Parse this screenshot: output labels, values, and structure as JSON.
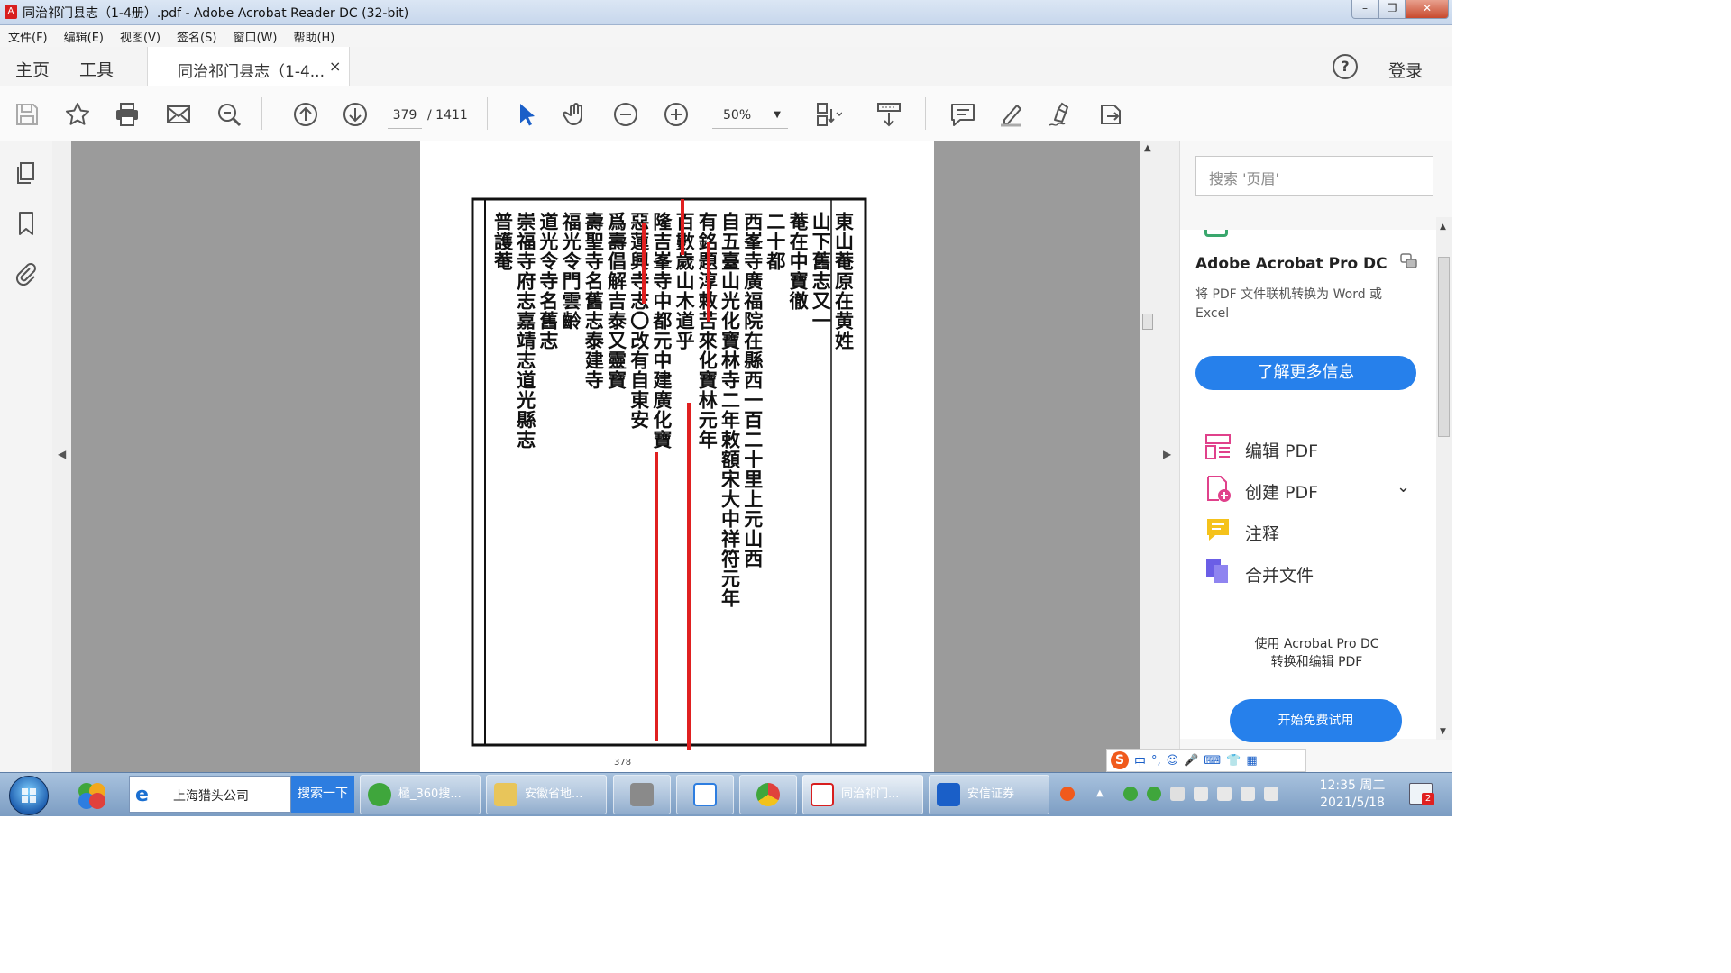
{
  "window": {
    "title": "同治祁门县志（1-4册）.pdf - Adobe Acrobat Reader DC (32-bit)",
    "app_icon": "pdf-icon",
    "controls": [
      "minimize",
      "maximize",
      "close"
    ]
  },
  "menu": [
    "文件(F)",
    "编辑(E)",
    "视图(V)",
    "签名(S)",
    "窗口(W)",
    "帮助(H)"
  ],
  "tabs": {
    "home": "主页",
    "tools": "工具",
    "document": "同治祁门县志（1-4...",
    "close_glyph": "×",
    "help_glyph": "?",
    "login": "登录"
  },
  "toolbar": {
    "current_page": "379",
    "total_pages": "/ 1411",
    "zoom": "50%",
    "zoom_arrow": "▼",
    "icons": [
      "save-icon",
      "star-icon",
      "print-icon",
      "mail-icon",
      "find-zoom-icon",
      "page-up-icon",
      "page-down-icon",
      "select-cursor-icon",
      "hand-icon",
      "zoom-out-icon",
      "zoom-in-icon",
      "page-layout-icon",
      "scroll-mode-icon",
      "comment-icon",
      "highlight-pen-icon",
      "sign-icon",
      "send-icon"
    ]
  },
  "page": {
    "columns": [
      "東山菴原在黄姓",
      "山下舊志又一",
      "菴在中寶徹",
      "二十都",
      "西峯寺廣福院在縣西一百二十里上元山西",
      "自五臺山光化寶林寺二年敕額宋大中祥符元年",
      "有銘題淳敕苦來化寶林元年",
      "百數歲山木道乎",
      "隆吉峯寺中都元中建廣化寶",
      "惡蓮興寺志〇改有自東安",
      "爲壽倡解吉泰又靈寶",
      "壽聖寺名舊志泰建寺",
      "福光令門雲齡",
      "道光令寺名舊志",
      "崇福寺府志嘉靖志道光縣志",
      "普護菴"
    ],
    "page_number": "378"
  },
  "right_panel": {
    "search_placeholder": "搜索 '页眉'",
    "product_title": "Adobe Acrobat Pro DC",
    "product_desc": "将 PDF 文件联机转换为 Word 或 Excel",
    "learn_more": "了解更多信息",
    "tools": [
      {
        "label": "编辑 PDF",
        "icon": "edit-pdf-icon"
      },
      {
        "label": "创建 PDF",
        "icon": "create-pdf-icon",
        "has_chevron": true
      },
      {
        "label": "注释",
        "icon": "comment-tool-icon"
      },
      {
        "label": "合并文件",
        "icon": "combine-files-icon"
      }
    ],
    "chevron": "⌄",
    "promo": "使用 Acrobat Pro DC\n转换和编辑 PDF",
    "trial_button": "开始免费试用"
  },
  "ime_bar": {
    "logo": "S",
    "mode": "中",
    "items": [
      "°,",
      "☺",
      "🎤",
      "⌨",
      "👕",
      "▦"
    ]
  },
  "taskbar": {
    "search_text": "上海猎头公司",
    "search_button": "搜索一下",
    "items": [
      {
        "label": "極_360搜...",
        "icon": "360-browser-icon"
      },
      {
        "label": "安徽省地...",
        "icon": "folder-icon"
      },
      {
        "label": "",
        "icon": "tools-icon"
      },
      {
        "label": "",
        "icon": "baidu-netdisk-icon"
      },
      {
        "label": "",
        "icon": "chrome-icon"
      },
      {
        "label": "同治祁门...",
        "icon": "acrobat-icon"
      },
      {
        "label": "安信证券",
        "icon": "securities-icon"
      }
    ],
    "clock_time": "12:35 周二",
    "clock_date": "2021/5/18",
    "notification_count": "2"
  },
  "colors": {
    "accent": "#2680eb",
    "annotation_red": "#e02020",
    "doc_bg": "#9b9b9b"
  }
}
